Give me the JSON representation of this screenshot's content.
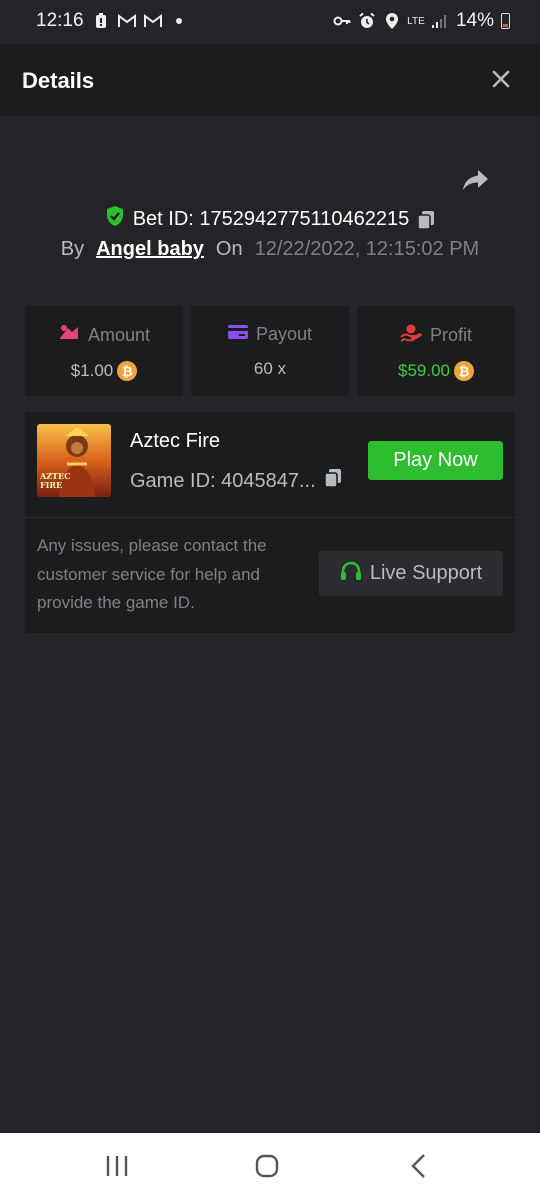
{
  "status_bar": {
    "time": "12:16",
    "left_icons": [
      "battery-alert-icon",
      "gmail-icon",
      "gmail-icon",
      "dot-icon"
    ],
    "right_icons": [
      "vpn-key-icon",
      "alarm-icon",
      "location-icon",
      "lte-icon",
      "signal-icon"
    ],
    "lte": "LTE",
    "battery": "14%"
  },
  "header": {
    "title": "Details",
    "close_icon": "close-icon"
  },
  "bet": {
    "bet_id_label": "Bet ID: 1752942775110462215",
    "by_label": "By",
    "user": "Angel baby",
    "on_label": "On",
    "datetime": "12/22/2022, 12:15:02 PM"
  },
  "stats": {
    "amount": {
      "label": "Amount",
      "value": "$1.00",
      "icon": "bet-chip-icon",
      "icon_color": "#e8407a"
    },
    "payout": {
      "label": "Payout",
      "value": "60 x",
      "icon": "card-icon",
      "icon_color": "#8a4bf0"
    },
    "profit": {
      "label": "Profit",
      "value": "$59.00",
      "icon": "money-hand-icon",
      "icon_color": "#e23b3b"
    }
  },
  "coin_symbol": "₿",
  "game": {
    "name": "Aztec Fire",
    "game_id": "Game ID: 4045847...",
    "thumb_text": "AZTEC FIRE",
    "play_label": "Play Now",
    "issue_text": "Any issues, please contact the customer service for help and provide the game ID.",
    "support_label": "Live Support"
  },
  "colors": {
    "accent_green": "#2ebd2e",
    "profit_green": "#3fcc3f",
    "background": "#232427",
    "card": "#1b1c1e"
  }
}
